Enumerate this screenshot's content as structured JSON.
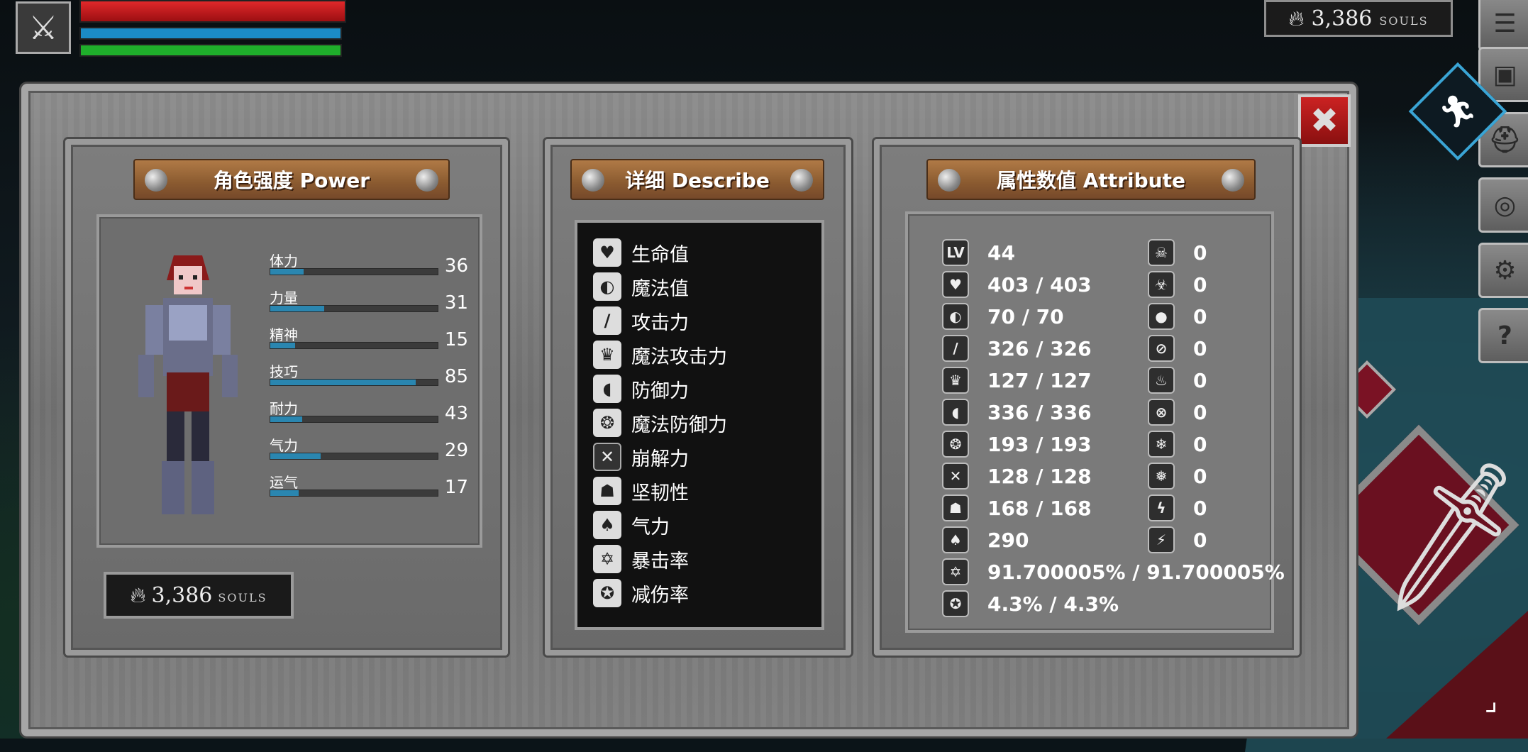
{
  "hud": {
    "hp_fill": 1.0,
    "mp_fill": 1.0,
    "stamina_fill": 1.0,
    "souls_value": "3,386",
    "souls_label": "SOULS"
  },
  "colors": {
    "hp": "#e0282a",
    "mp": "#1b8bc6",
    "stamina": "#1fae2b",
    "stat_bar": "#2a86b0",
    "close": "#c22222"
  },
  "power_panel": {
    "title": "角色强度 Power",
    "stats": [
      {
        "name": "体力",
        "value": "36",
        "fill": 0.2
      },
      {
        "name": "力量",
        "value": "31",
        "fill": 0.32
      },
      {
        "name": "精神",
        "value": "15",
        "fill": 0.15
      },
      {
        "name": "技巧",
        "value": "85",
        "fill": 0.87
      },
      {
        "name": "耐力",
        "value": "43",
        "fill": 0.19
      },
      {
        "name": "气力",
        "value": "29",
        "fill": 0.3
      },
      {
        "name": "运气",
        "value": "17",
        "fill": 0.17
      }
    ],
    "souls_value": "3,386",
    "souls_label": "SOULS"
  },
  "describe_panel": {
    "title": "详细 Describe",
    "items": [
      {
        "icon": "heart-icon",
        "label": "生命值"
      },
      {
        "icon": "head-icon",
        "label": "魔法值"
      },
      {
        "icon": "sword-icon",
        "label": "攻击力"
      },
      {
        "icon": "magic-book-icon",
        "label": "魔法攻击力"
      },
      {
        "icon": "shield-icon",
        "label": "防御力"
      },
      {
        "icon": "magic-shield-icon",
        "label": "魔法防御力"
      },
      {
        "icon": "break-icon",
        "label": "崩解力"
      },
      {
        "icon": "helmet-icon",
        "label": "坚韧性"
      },
      {
        "icon": "lungs-icon",
        "label": "气力"
      },
      {
        "icon": "star-burst-icon",
        "label": "暴击率"
      },
      {
        "icon": "damage-reduction-icon",
        "label": "减伤率"
      }
    ]
  },
  "attribute_panel": {
    "title": "属性数值 Attribute",
    "left": [
      {
        "icon": "level-icon",
        "icon_text": "LV",
        "value": "44"
      },
      {
        "icon": "heart-icon",
        "value": "403 / 403"
      },
      {
        "icon": "head-icon",
        "value": "70 / 70"
      },
      {
        "icon": "sword-icon",
        "value": "326 / 326"
      },
      {
        "icon": "magic-book-icon",
        "value": "127 / 127"
      },
      {
        "icon": "shield-icon",
        "value": "336 / 336"
      },
      {
        "icon": "magic-shield-icon",
        "value": "193 / 193"
      },
      {
        "icon": "break-icon",
        "value": "128 / 128"
      },
      {
        "icon": "helmet-icon",
        "value": "168 / 168"
      },
      {
        "icon": "lungs-icon",
        "value": "290"
      },
      {
        "icon": "star-burst-icon",
        "value": "91.700005% / 91.700005%"
      },
      {
        "icon": "damage-reduction-icon",
        "value": "4.3% / 4.3%"
      }
    ],
    "right": [
      {
        "icon": "poison-skull-icon",
        "value": "0"
      },
      {
        "icon": "toxic-skull-icon",
        "value": "0"
      },
      {
        "icon": "bleed-drop-icon",
        "value": "0"
      },
      {
        "icon": "bleed-resist-icon",
        "value": "0"
      },
      {
        "icon": "fire-icon",
        "value": "0"
      },
      {
        "icon": "fire-resist-icon",
        "value": "0"
      },
      {
        "icon": "frost-icon",
        "value": "0"
      },
      {
        "icon": "frost-resist-icon",
        "value": "0"
      },
      {
        "icon": "lightning-icon",
        "value": "0"
      },
      {
        "icon": "lightning-resist-icon",
        "value": "0"
      }
    ]
  }
}
